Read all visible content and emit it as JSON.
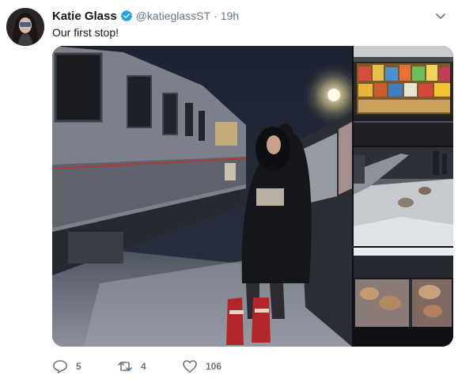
{
  "tweet": {
    "display_name": "Katie Glass",
    "handle": "@katieglassST",
    "separator": "·",
    "time": "19h",
    "text": "Our first stop!",
    "verified": true
  },
  "actions": {
    "replies": "5",
    "retweets": "4",
    "likes": "106"
  },
  "icons": {
    "reply": "reply-icon",
    "retweet": "retweet-icon",
    "like": "heart-icon",
    "menu": "chevron-down-icon",
    "verified": "verified-badge-icon"
  },
  "colors": {
    "verified": "#1da1f2",
    "muted": "#657786",
    "text": "#14171a"
  }
}
